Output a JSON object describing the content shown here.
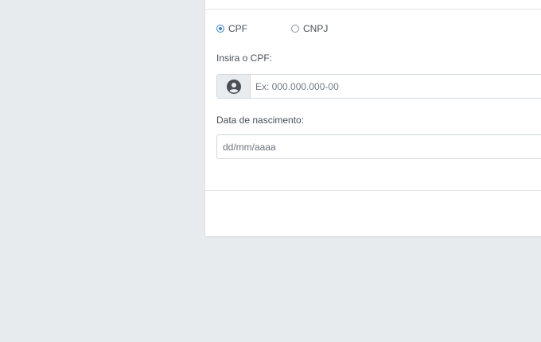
{
  "document_type": {
    "options": [
      {
        "label": "CPF",
        "selected": true
      },
      {
        "label": "CNPJ",
        "selected": false
      }
    ]
  },
  "cpf": {
    "label": "Insira o CPF:",
    "placeholder": "Ex: 000.000.000-00",
    "icon": "user-circle-icon"
  },
  "birth_date": {
    "label": "Data de nascimento:",
    "placeholder": "dd/mm/aaaa"
  },
  "colors": {
    "accent": "#3a80d2",
    "background": "#e8ebee"
  }
}
